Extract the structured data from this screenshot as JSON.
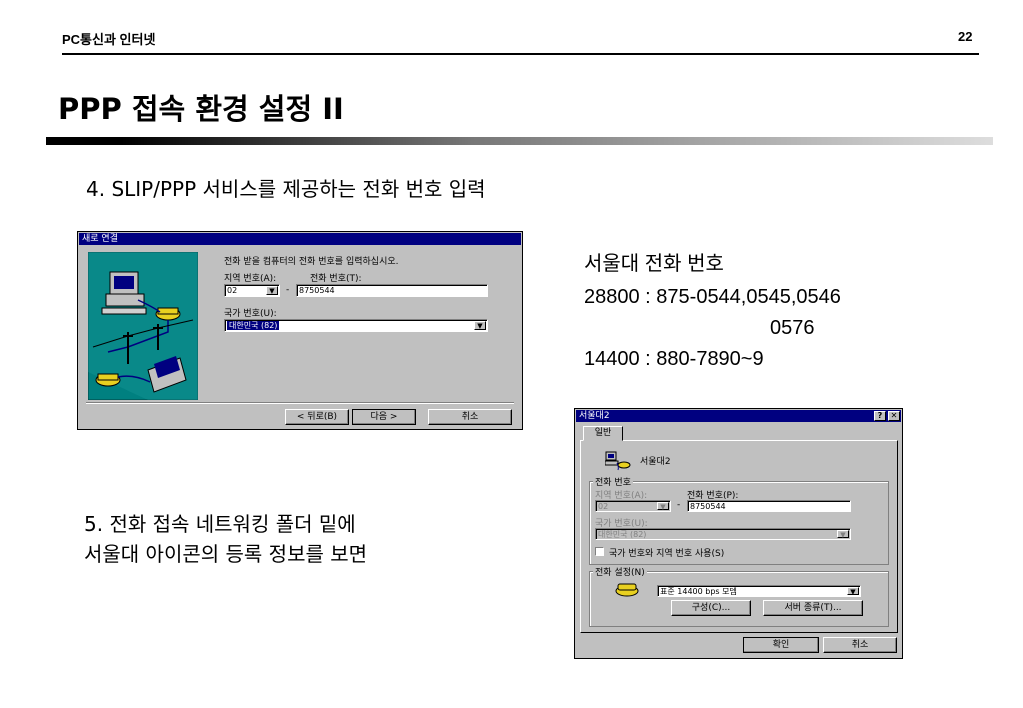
{
  "header": {
    "left": "PC통신과 인터넷",
    "page_number": "22"
  },
  "title": "PPP 접속 환경 설정 II",
  "step4": "4. SLIP/PPP 서비스를 제공하는 전화 번호 입력",
  "step5": {
    "line1": "5. 전화 접속 네트워킹 폴더 밑에",
    "line2": "서울대 아이콘의 등록 정보를 보면"
  },
  "info": {
    "line1": "서울대 전화 번호",
    "line2": "28800 : 875-0544,0545,0546",
    "line3": "0576",
    "line4": "14400 : 880-7890~9"
  },
  "wizard": {
    "title": "새로 연결",
    "prompt": "전화 받을 컴퓨터의 전화 번호를 입력하십시오.",
    "area_code_label": "지역 번호(A):",
    "area_code_value": "02",
    "phone_label": "전화 번호(T):",
    "phone_value": "8750544",
    "dash": "-",
    "country_label": "국가 번호(U):",
    "country_value": "대한민국 (82)",
    "back_button": "< 뒤로(B)",
    "next_button": "다음 >",
    "cancel_button": "취소"
  },
  "props": {
    "title": "서울대2",
    "help_btn": "?",
    "close_btn": "✕",
    "tab_general": "일반",
    "connection_name": "서울대2",
    "phone_group": "전화 번호",
    "area_code_label": "지역 번호(A):",
    "area_code_value": "02",
    "phone_label": "전화 번호(P):",
    "phone_value": "8750544",
    "dash": "-",
    "country_label": "국가 번호(U):",
    "country_value": "대한민국 (82)",
    "use_country_checkbox": "국가 번호와 지역 번호 사용(S)",
    "device_group": "전화 설정(N)",
    "modem_value": "표준 14400 bps 모뎀",
    "configure_button": "구성(C)...",
    "server_type_button": "서버 종류(T)...",
    "ok_button": "확인",
    "cancel_button": "취소"
  },
  "colors": {
    "titlebar": "#000080",
    "window_bg": "#c0c0c0",
    "wizard_art_bg": "#008080"
  }
}
